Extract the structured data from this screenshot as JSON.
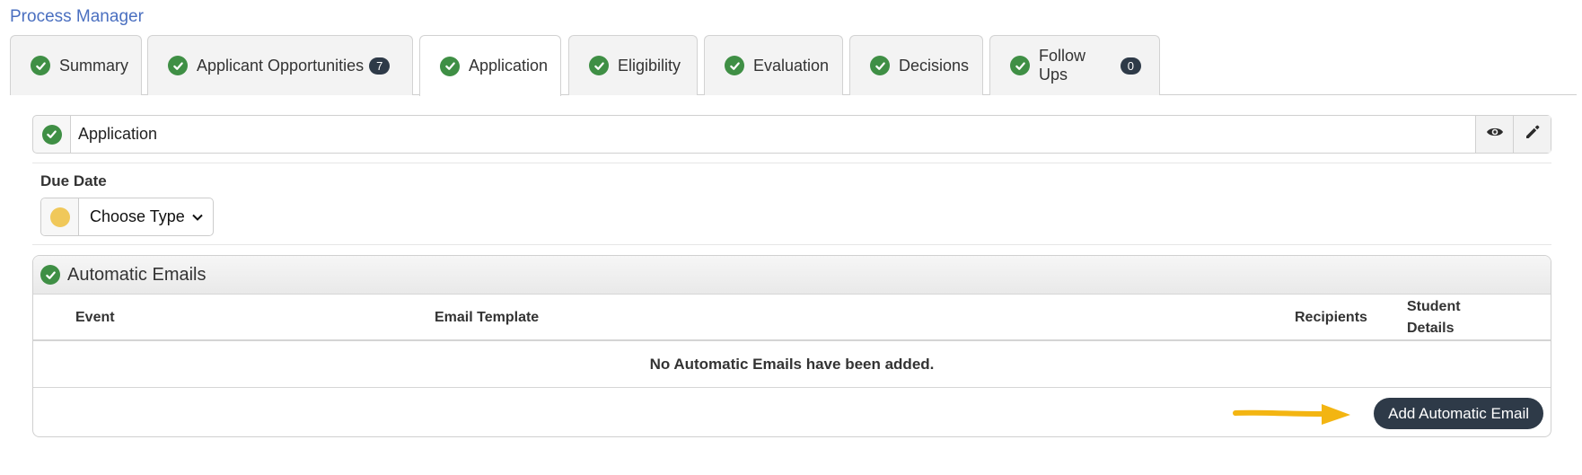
{
  "header": {
    "title": "Process Manager"
  },
  "tabs": [
    {
      "label": "Summary",
      "badge": ""
    },
    {
      "label": "Applicant Opportunities",
      "badge": "7"
    },
    {
      "label": "Application",
      "badge": ""
    },
    {
      "label": "Eligibility",
      "badge": ""
    },
    {
      "label": "Evaluation",
      "badge": ""
    },
    {
      "label": "Decisions",
      "badge": ""
    },
    {
      "label": "Follow Ups",
      "badge": "0"
    }
  ],
  "active_tab": "Application",
  "section": {
    "label": "Application"
  },
  "due_date": {
    "label": "Due Date",
    "selected": "Choose Type"
  },
  "automatic_emails": {
    "title": "Automatic Emails",
    "columns": [
      "Event",
      "Email Template",
      "Recipients",
      "Student Details"
    ],
    "empty_message": "No Automatic Emails have been added.",
    "add_button": "Add Automatic Email"
  },
  "colors": {
    "success": "#3f8f45",
    "warning": "#f0c85a",
    "dark": "#2e3a48",
    "link": "#4a6fc0",
    "arrow": "#f3b512"
  },
  "icons": [
    "check-circle-icon",
    "eye-icon",
    "pencil-icon",
    "chevron-down-icon",
    "arrow-right-icon"
  ]
}
